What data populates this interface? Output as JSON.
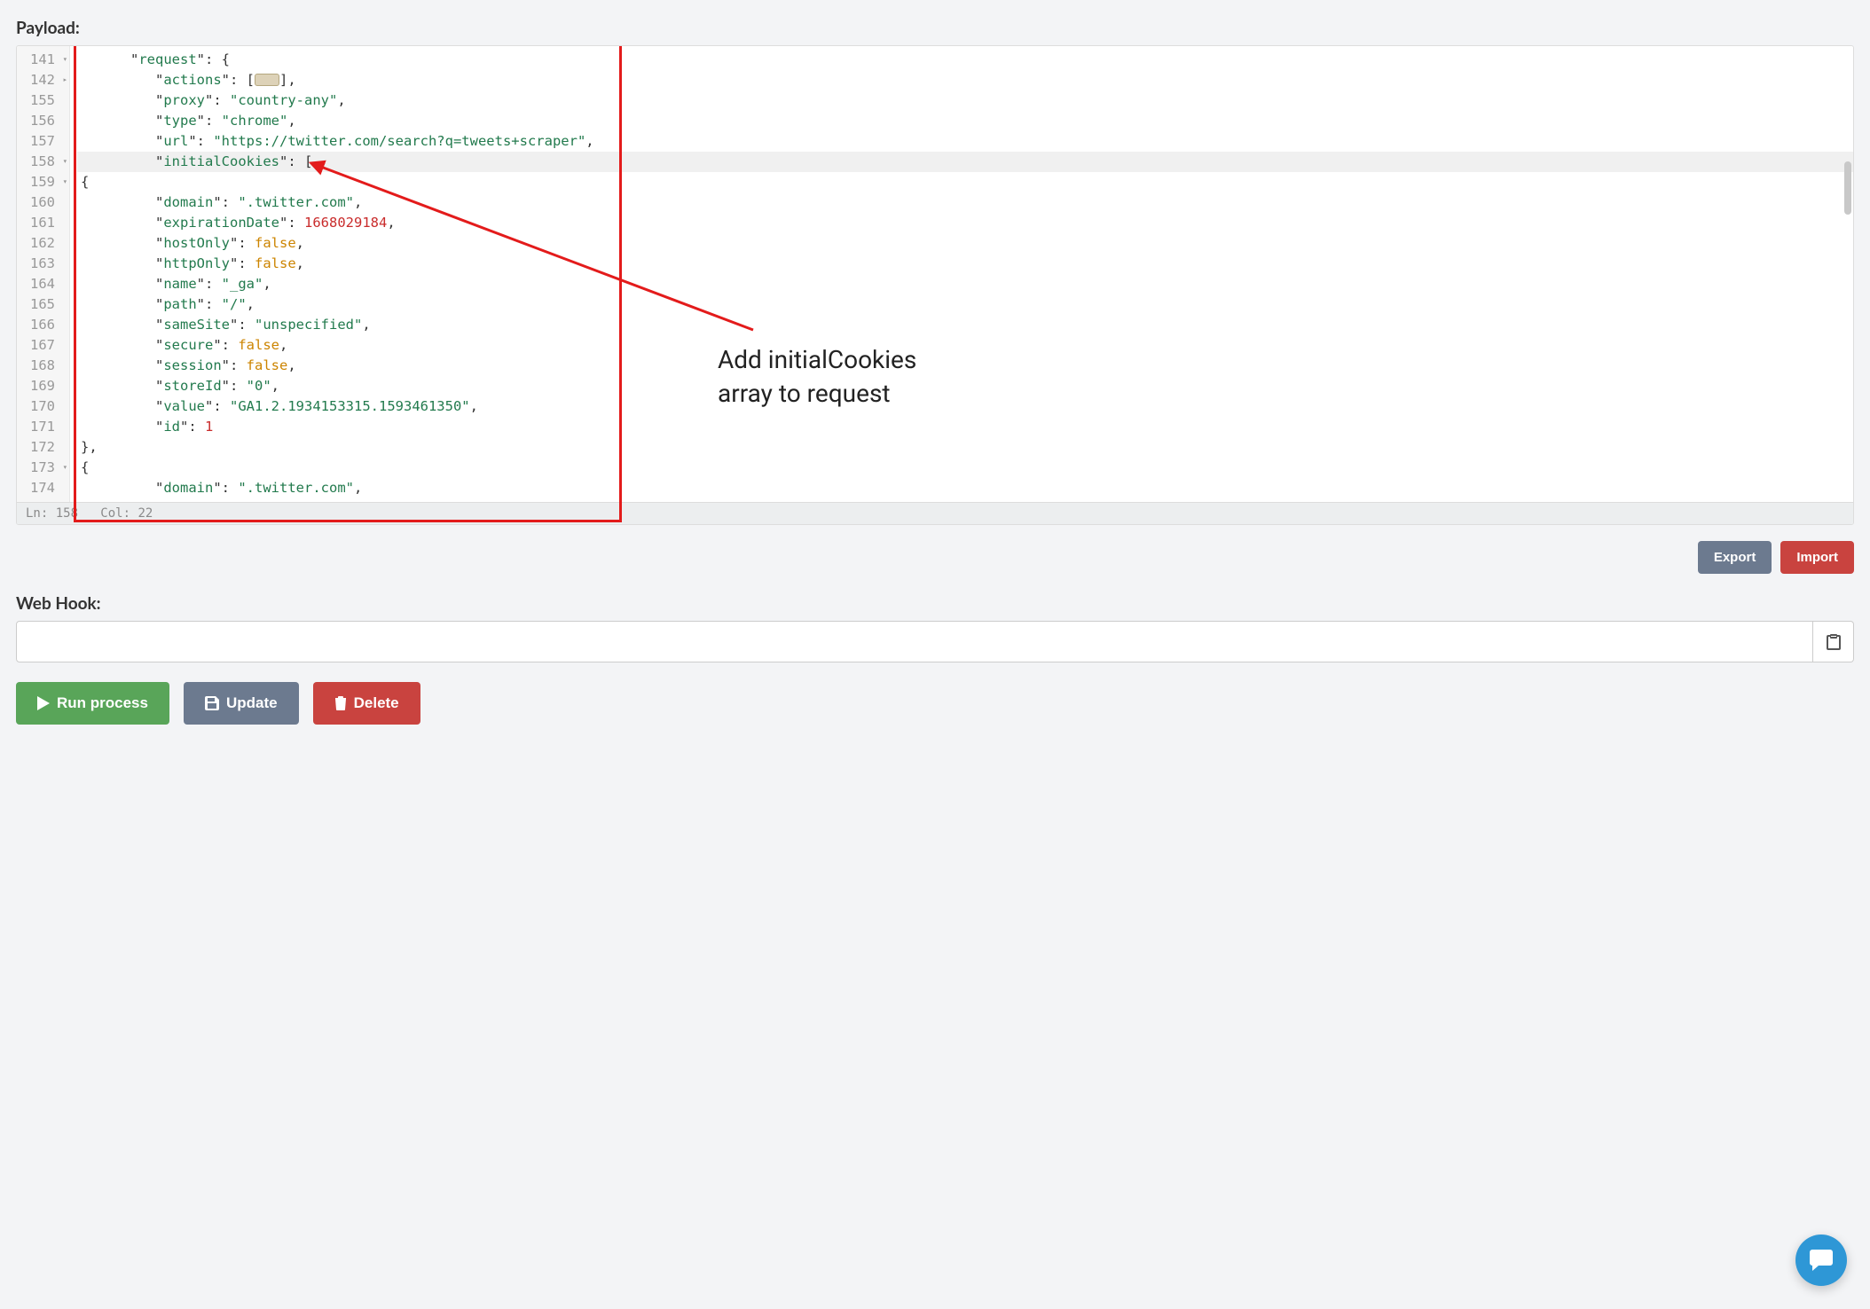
{
  "labels": {
    "payload": "Payload:",
    "webhook": "Web Hook:"
  },
  "buttons": {
    "export": "Export",
    "import": "Import",
    "run": "Run process",
    "update": "Update",
    "delete": "Delete"
  },
  "webhook": {
    "value": ""
  },
  "statusbar": {
    "ln": "158",
    "col": "22"
  },
  "annotation": {
    "line1": "Add initialCookies",
    "line2": "array to request"
  },
  "editor": {
    "lines": [
      {
        "num": "141",
        "fold": "v",
        "indent": 2,
        "seg": [
          {
            "t": "\"",
            "c": "p"
          },
          {
            "t": "request",
            "c": "k"
          },
          {
            "t": "\": {",
            "c": "p"
          }
        ]
      },
      {
        "num": "142",
        "fold": ">",
        "indent": 3,
        "seg": [
          {
            "t": "\"",
            "c": "p"
          },
          {
            "t": "actions",
            "c": "k"
          },
          {
            "t": "\": [",
            "c": "p"
          },
          {
            "t": "BADGE"
          },
          {
            "t": "],",
            "c": "p"
          }
        ]
      },
      {
        "num": "155",
        "indent": 3,
        "seg": [
          {
            "t": "\"",
            "c": "p"
          },
          {
            "t": "proxy",
            "c": "k"
          },
          {
            "t": "\": ",
            "c": "p"
          },
          {
            "t": "\"country-any\"",
            "c": "s"
          },
          {
            "t": ",",
            "c": "p"
          }
        ]
      },
      {
        "num": "156",
        "indent": 3,
        "seg": [
          {
            "t": "\"",
            "c": "p"
          },
          {
            "t": "type",
            "c": "k"
          },
          {
            "t": "\": ",
            "c": "p"
          },
          {
            "t": "\"chrome\"",
            "c": "s"
          },
          {
            "t": ",",
            "c": "p"
          }
        ]
      },
      {
        "num": "157",
        "indent": 3,
        "seg": [
          {
            "t": "\"",
            "c": "p"
          },
          {
            "t": "url",
            "c": "k"
          },
          {
            "t": "\": ",
            "c": "p"
          },
          {
            "t": "\"https://twitter.com/search?q=tweets+scraper\"",
            "c": "s"
          },
          {
            "t": ",",
            "c": "p"
          }
        ]
      },
      {
        "num": "158",
        "fold": "v",
        "hl": true,
        "indent": 3,
        "seg": [
          {
            "t": "\"",
            "c": "p"
          },
          {
            "t": "initialCookies",
            "c": "k"
          },
          {
            "t": "\": [",
            "c": "p"
          }
        ]
      },
      {
        "num": "159",
        "fold": "v",
        "indent": 0,
        "seg": [
          {
            "t": "{",
            "c": "p"
          }
        ]
      },
      {
        "num": "160",
        "indent": 3,
        "seg": [
          {
            "t": "\"",
            "c": "p"
          },
          {
            "t": "domain",
            "c": "k"
          },
          {
            "t": "\": ",
            "c": "p"
          },
          {
            "t": "\".twitter.com\"",
            "c": "s"
          },
          {
            "t": ",",
            "c": "p"
          }
        ]
      },
      {
        "num": "161",
        "indent": 3,
        "seg": [
          {
            "t": "\"",
            "c": "p"
          },
          {
            "t": "expirationDate",
            "c": "k"
          },
          {
            "t": "\": ",
            "c": "p"
          },
          {
            "t": "1668029184",
            "c": "n"
          },
          {
            "t": ",",
            "c": "p"
          }
        ]
      },
      {
        "num": "162",
        "indent": 3,
        "seg": [
          {
            "t": "\"",
            "c": "p"
          },
          {
            "t": "hostOnly",
            "c": "k"
          },
          {
            "t": "\": ",
            "c": "p"
          },
          {
            "t": "false",
            "c": "b"
          },
          {
            "t": ",",
            "c": "p"
          }
        ]
      },
      {
        "num": "163",
        "indent": 3,
        "seg": [
          {
            "t": "\"",
            "c": "p"
          },
          {
            "t": "httpOnly",
            "c": "k"
          },
          {
            "t": "\": ",
            "c": "p"
          },
          {
            "t": "false",
            "c": "b"
          },
          {
            "t": ",",
            "c": "p"
          }
        ]
      },
      {
        "num": "164",
        "indent": 3,
        "seg": [
          {
            "t": "\"",
            "c": "p"
          },
          {
            "t": "name",
            "c": "k"
          },
          {
            "t": "\": ",
            "c": "p"
          },
          {
            "t": "\"_ga\"",
            "c": "s"
          },
          {
            "t": ",",
            "c": "p"
          }
        ]
      },
      {
        "num": "165",
        "indent": 3,
        "seg": [
          {
            "t": "\"",
            "c": "p"
          },
          {
            "t": "path",
            "c": "k"
          },
          {
            "t": "\": ",
            "c": "p"
          },
          {
            "t": "\"/\"",
            "c": "s"
          },
          {
            "t": ",",
            "c": "p"
          }
        ]
      },
      {
        "num": "166",
        "indent": 3,
        "seg": [
          {
            "t": "\"",
            "c": "p"
          },
          {
            "t": "sameSite",
            "c": "k"
          },
          {
            "t": "\": ",
            "c": "p"
          },
          {
            "t": "\"unspecified\"",
            "c": "s"
          },
          {
            "t": ",",
            "c": "p"
          }
        ]
      },
      {
        "num": "167",
        "indent": 3,
        "seg": [
          {
            "t": "\"",
            "c": "p"
          },
          {
            "t": "secure",
            "c": "k"
          },
          {
            "t": "\": ",
            "c": "p"
          },
          {
            "t": "false",
            "c": "b"
          },
          {
            "t": ",",
            "c": "p"
          }
        ]
      },
      {
        "num": "168",
        "indent": 3,
        "seg": [
          {
            "t": "\"",
            "c": "p"
          },
          {
            "t": "session",
            "c": "k"
          },
          {
            "t": "\": ",
            "c": "p"
          },
          {
            "t": "false",
            "c": "b"
          },
          {
            "t": ",",
            "c": "p"
          }
        ]
      },
      {
        "num": "169",
        "indent": 3,
        "seg": [
          {
            "t": "\"",
            "c": "p"
          },
          {
            "t": "storeId",
            "c": "k"
          },
          {
            "t": "\": ",
            "c": "p"
          },
          {
            "t": "\"0\"",
            "c": "s"
          },
          {
            "t": ",",
            "c": "p"
          }
        ]
      },
      {
        "num": "170",
        "indent": 3,
        "seg": [
          {
            "t": "\"",
            "c": "p"
          },
          {
            "t": "value",
            "c": "k"
          },
          {
            "t": "\": ",
            "c": "p"
          },
          {
            "t": "\"GA1.2.1934153315.1593461350\"",
            "c": "s"
          },
          {
            "t": ",",
            "c": "p"
          }
        ]
      },
      {
        "num": "171",
        "indent": 3,
        "seg": [
          {
            "t": "\"",
            "c": "p"
          },
          {
            "t": "id",
            "c": "k"
          },
          {
            "t": "\": ",
            "c": "p"
          },
          {
            "t": "1",
            "c": "n"
          }
        ]
      },
      {
        "num": "172",
        "indent": 0,
        "seg": [
          {
            "t": "},",
            "c": "p"
          }
        ]
      },
      {
        "num": "173",
        "fold": "v",
        "indent": 0,
        "seg": [
          {
            "t": "{",
            "c": "p"
          }
        ]
      },
      {
        "num": "174",
        "indent": 3,
        "seg": [
          {
            "t": "\"",
            "c": "p"
          },
          {
            "t": "domain",
            "c": "k"
          },
          {
            "t": "\": ",
            "c": "p"
          },
          {
            "t": "\".twitter.com\"",
            "c": "s"
          },
          {
            "t": ",",
            "c": "p"
          }
        ]
      }
    ]
  }
}
